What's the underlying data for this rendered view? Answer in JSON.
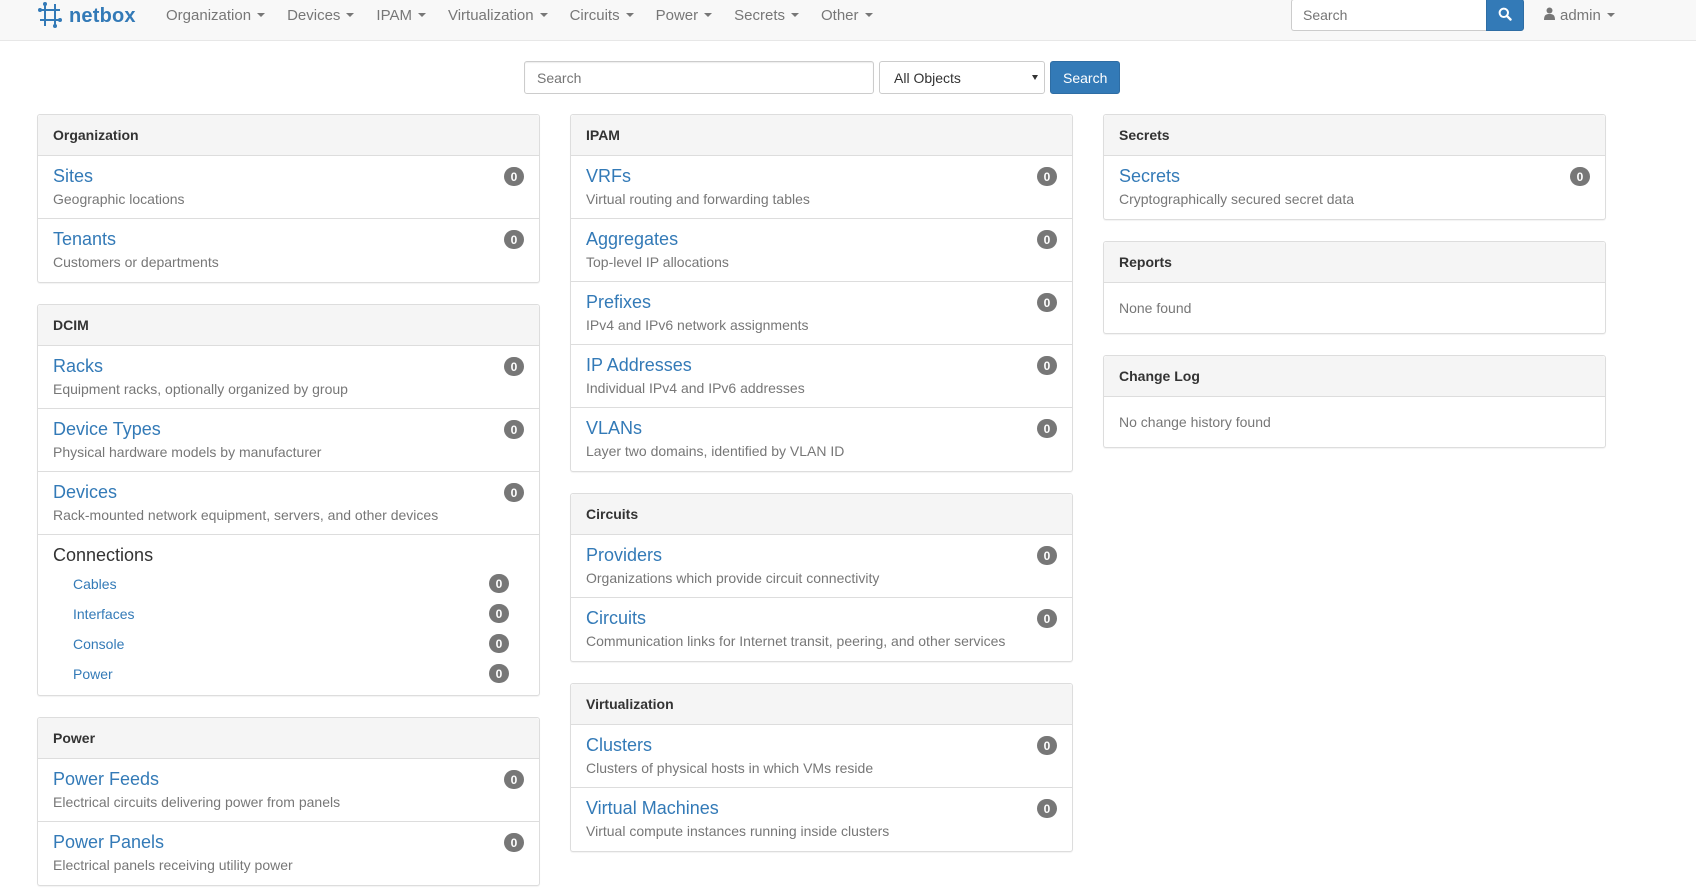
{
  "navbar": {
    "brand": "netbox",
    "menu": [
      {
        "label": "Organization"
      },
      {
        "label": "Devices"
      },
      {
        "label": "IPAM"
      },
      {
        "label": "Virtualization"
      },
      {
        "label": "Circuits"
      },
      {
        "label": "Power"
      },
      {
        "label": "Secrets"
      },
      {
        "label": "Other"
      }
    ],
    "search_placeholder": "Search",
    "user": "admin"
  },
  "search": {
    "placeholder": "Search",
    "select_value": "All Objects",
    "button": "Search"
  },
  "organization": {
    "heading": "Organization",
    "items": [
      {
        "title": "Sites",
        "desc": "Geographic locations",
        "count": "0"
      },
      {
        "title": "Tenants",
        "desc": "Customers or departments",
        "count": "0"
      }
    ]
  },
  "dcim": {
    "heading": "DCIM",
    "items": [
      {
        "title": "Racks",
        "desc": "Equipment racks, optionally organized by group",
        "count": "0"
      },
      {
        "title": "Device Types",
        "desc": "Physical hardware models by manufacturer",
        "count": "0"
      },
      {
        "title": "Devices",
        "desc": "Rack-mounted network equipment, servers, and other devices",
        "count": "0"
      }
    ],
    "connections": {
      "title": "Connections",
      "items": [
        {
          "label": "Cables",
          "count": "0"
        },
        {
          "label": "Interfaces",
          "count": "0"
        },
        {
          "label": "Console",
          "count": "0"
        },
        {
          "label": "Power",
          "count": "0"
        }
      ]
    }
  },
  "power": {
    "heading": "Power",
    "items": [
      {
        "title": "Power Feeds",
        "desc": "Electrical circuits delivering power from panels",
        "count": "0"
      },
      {
        "title": "Power Panels",
        "desc": "Electrical panels receiving utility power",
        "count": "0"
      }
    ]
  },
  "ipam": {
    "heading": "IPAM",
    "items": [
      {
        "title": "VRFs",
        "desc": "Virtual routing and forwarding tables",
        "count": "0"
      },
      {
        "title": "Aggregates",
        "desc": "Top-level IP allocations",
        "count": "0"
      },
      {
        "title": "Prefixes",
        "desc": "IPv4 and IPv6 network assignments",
        "count": "0"
      },
      {
        "title": "IP Addresses",
        "desc": "Individual IPv4 and IPv6 addresses",
        "count": "0"
      },
      {
        "title": "VLANs",
        "desc": "Layer two domains, identified by VLAN ID",
        "count": "0"
      }
    ]
  },
  "circuits": {
    "heading": "Circuits",
    "items": [
      {
        "title": "Providers",
        "desc": "Organizations which provide circuit connectivity",
        "count": "0"
      },
      {
        "title": "Circuits",
        "desc": "Communication links for Internet transit, peering, and other services",
        "count": "0"
      }
    ]
  },
  "virtualization": {
    "heading": "Virtualization",
    "items": [
      {
        "title": "Clusters",
        "desc": "Clusters of physical hosts in which VMs reside",
        "count": "0"
      },
      {
        "title": "Virtual Machines",
        "desc": "Virtual compute instances running inside clusters",
        "count": "0"
      }
    ]
  },
  "secrets": {
    "heading": "Secrets",
    "items": [
      {
        "title": "Secrets",
        "desc": "Cryptographically secured secret data",
        "count": "0"
      }
    ]
  },
  "reports": {
    "heading": "Reports",
    "body": "None found"
  },
  "changelog": {
    "heading": "Change Log",
    "body": "No change history found"
  },
  "colors": {
    "link": "#337ab7",
    "badge": "#777777",
    "muted": "#777777"
  }
}
